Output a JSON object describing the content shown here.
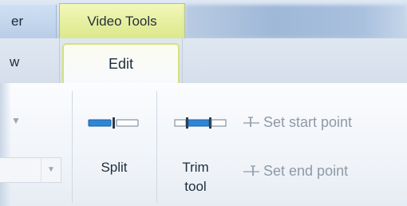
{
  "ribbon_context": {
    "left_tab_fragment": "er",
    "contextual_group": "Video Tools"
  },
  "tabs": [
    {
      "label": "w"
    },
    {
      "label": "Edit"
    }
  ],
  "editing_group": {
    "split_label": "Split",
    "trim_label_line1": "Trim",
    "trim_label_line2": "tool",
    "set_start_point_label": "Set start point",
    "set_end_point_label": "Set end point"
  },
  "icons": {
    "split": "split-icon",
    "trim": "trim-tool-icon",
    "set_start": "set-start-point-icon",
    "set_end": "set-end-point-icon",
    "dropdown": "chevron-down-icon"
  },
  "colors": {
    "contextual_accent": "#dbe88a",
    "icon_blue": "#2e86d6",
    "disabled_text": "#8f9aa6"
  }
}
